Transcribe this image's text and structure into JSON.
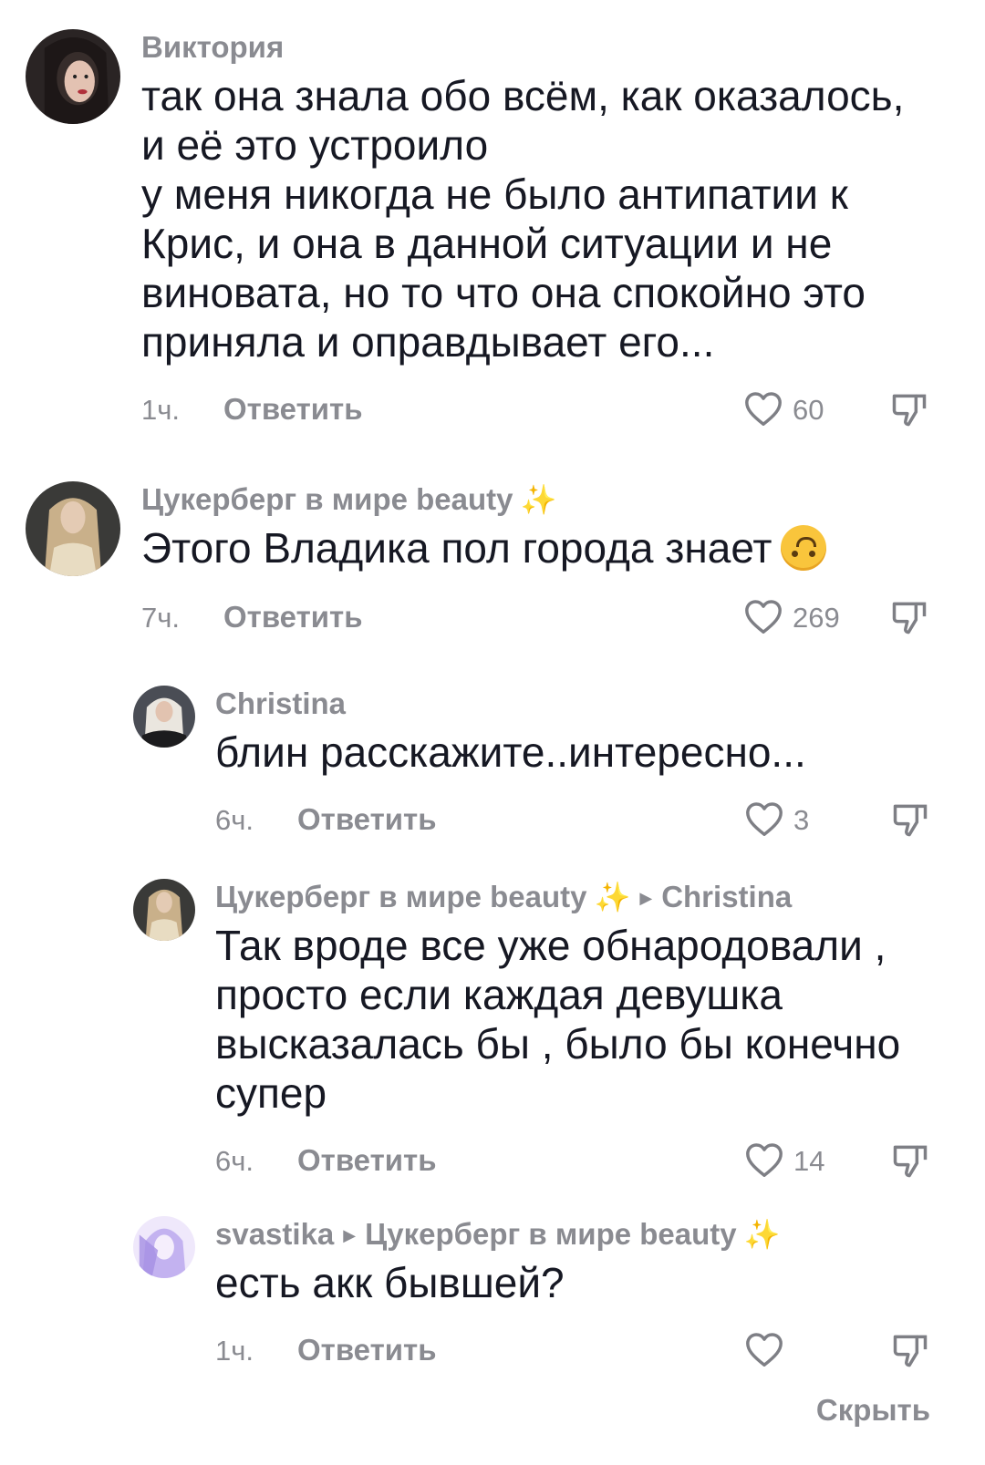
{
  "comments": [
    {
      "author": "Виктория",
      "text_lines": [
        "так она знала обо всём, как оказалось,",
        "и её это устроило",
        "у меня никогда не было антипатии к",
        "Крис, и она в данной ситуации и не",
        "виновата, но то что она спокойно это",
        "приняла и оправдывает его..."
      ],
      "time": "1ч.",
      "reply": "Ответить",
      "likes": "60"
    },
    {
      "author": "Цукерберг в мире beauty",
      "author_emoji": "✨",
      "text": "Этого Владика пол города знает",
      "text_emoji": "upside-down-face",
      "time": "7ч.",
      "reply": "Ответить",
      "likes": "269"
    },
    {
      "author": "Christina",
      "text": "блин расскажите..интересно...",
      "time": "6ч.",
      "reply": "Ответить",
      "likes": "3"
    },
    {
      "author": "Цукерберг в мире beauty",
      "author_emoji": "✨",
      "reply_to": "Christina",
      "text_lines": [
        "Так вроде все уже обнародовали ,",
        "просто если каждая девушка",
        "высказалась бы , было бы конечно",
        "супер"
      ],
      "time": "6ч.",
      "reply": "Ответить",
      "likes": "14"
    },
    {
      "author": "svastika",
      "reply_to": "Цукерберг в мире beauty",
      "reply_to_emoji": "✨",
      "text": "есть акк бывшей?",
      "time": "1ч.",
      "reply": "Ответить",
      "likes": ""
    }
  ],
  "hide_label": "Скрыть",
  "icons": {
    "like": "heart-outline-icon",
    "dislike": "thumbs-down-icon",
    "reply_arrow": "triangle-right-icon"
  },
  "colors": {
    "text": "#161823",
    "muted": "#8a8b91",
    "background": "#ffffff"
  }
}
